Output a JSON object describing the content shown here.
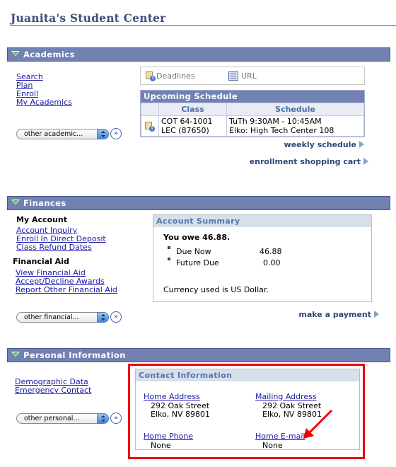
{
  "page": {
    "title": "Juanita's Student Center"
  },
  "academics": {
    "section_label": "Academics",
    "links": [
      "Search",
      "Plan",
      "Enroll",
      "My Academics"
    ],
    "dropdown_value": "other academic...",
    "go_label": "»",
    "quick_links": {
      "deadlines": "Deadlines",
      "url": "URL"
    },
    "schedule": {
      "title": "Upcoming Schedule",
      "columns": [
        "Class",
        "Schedule"
      ],
      "rows": [
        {
          "class_line1": "COT 64-1001",
          "class_line2": "LEC (87650)",
          "sched_line1": "TuTh 9:30AM - 10:45AM",
          "sched_line2": "Elko: High Tech Center 108"
        }
      ]
    },
    "weekly_schedule": "weekly schedule",
    "shopping_cart": "enrollment shopping cart"
  },
  "finances": {
    "section_label": "Finances",
    "my_account": {
      "heading": "My Account",
      "links": [
        "Account Inquiry",
        "Enroll In Direct Deposit",
        "Class Refund Dates"
      ]
    },
    "financial_aid": {
      "heading": "Financial Aid",
      "links": [
        "View Financial Aid",
        "Accept/Decline Awards",
        "Report Other Financial Aid"
      ]
    },
    "dropdown_value": "other financial...",
    "go_label": "»",
    "summary": {
      "title": "Account Summary",
      "owe_text": "You owe 46.88.",
      "items": [
        {
          "label": "Due Now",
          "amount": "46.88"
        },
        {
          "label": "Future Due",
          "amount": "0.00"
        }
      ],
      "currency_note": "Currency used is US Dollar."
    },
    "make_payment": "make a payment"
  },
  "personal": {
    "section_label": "Personal Information",
    "links": [
      "Demographic Data",
      "Emergency Contact"
    ],
    "dropdown_value": "other personal...",
    "go_label": "»",
    "contact": {
      "title": "Contact Information",
      "home_address": {
        "label": "Home Address",
        "line1": "292 Oak Street",
        "line2": "Elko, NV 89801"
      },
      "mailing_address": {
        "label": "Mailing Address",
        "line1": "292 Oak Street",
        "line2": "Elko, NV 89801"
      },
      "home_phone": {
        "label": "Home Phone",
        "value": "None"
      },
      "home_email": {
        "label": "Home E-mail",
        "value": "None"
      }
    }
  },
  "annotation": {
    "highlight_color": "#ee0000"
  }
}
